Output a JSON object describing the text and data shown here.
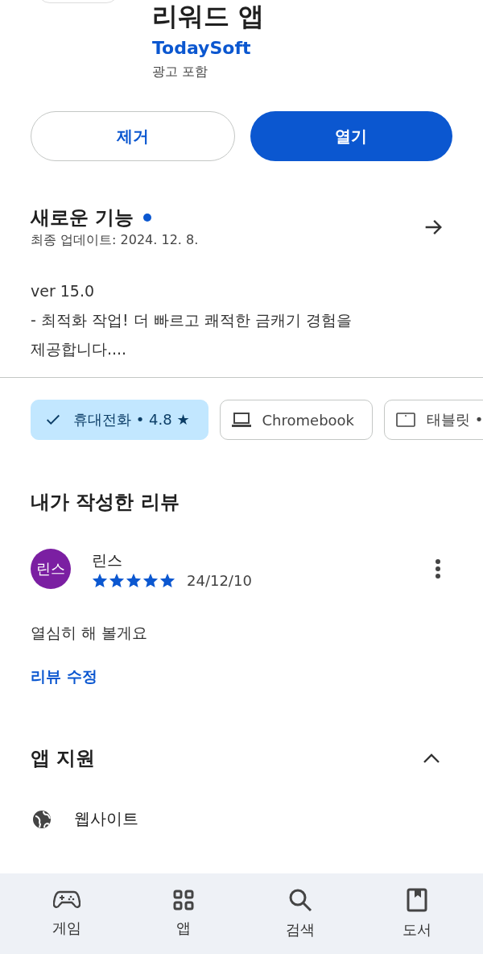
{
  "app": {
    "title": "리워드 앱",
    "developer": "TodaySoft",
    "note": "광고 포함"
  },
  "actions": [
    {
      "label": "제거",
      "kind": "outline"
    },
    {
      "label": "열기",
      "kind": "filled"
    }
  ],
  "whats_new": {
    "title": "새로운 기능",
    "new_dot": true,
    "updated": "최종 업데이트: 2024. 12. 8.",
    "lines": [
      "ver 15.0",
      "- 최적화 작업! 더 빠르고 쾌적한 금캐기 경험을",
      "제공합니다...."
    ]
  },
  "device_chips": [
    {
      "label": "휴대전화 • 4.8 ★",
      "kind": "phone",
      "selected": true
    },
    {
      "label": "Chromebook",
      "kind": "laptop",
      "selected": false
    },
    {
      "label": "태블릿 •",
      "kind": "tablet",
      "selected": false
    }
  ],
  "my_review": {
    "title": "내가 작성한 리뷰",
    "avatar": "린스",
    "author": "린스",
    "stars": 5,
    "date": "24/12/10",
    "text": "열심히 해 볼게요",
    "edit_link": "리뷰 수정"
  },
  "app_support": {
    "title": "앱 지원",
    "expanded": true,
    "items": [
      {
        "label": "웹사이트",
        "kind": "globe"
      }
    ]
  },
  "bottom_nav": [
    {
      "label": "게임",
      "kind": "games"
    },
    {
      "label": "앱",
      "kind": "apps"
    },
    {
      "label": "검색",
      "kind": "search"
    },
    {
      "label": "도서",
      "kind": "books"
    }
  ]
}
